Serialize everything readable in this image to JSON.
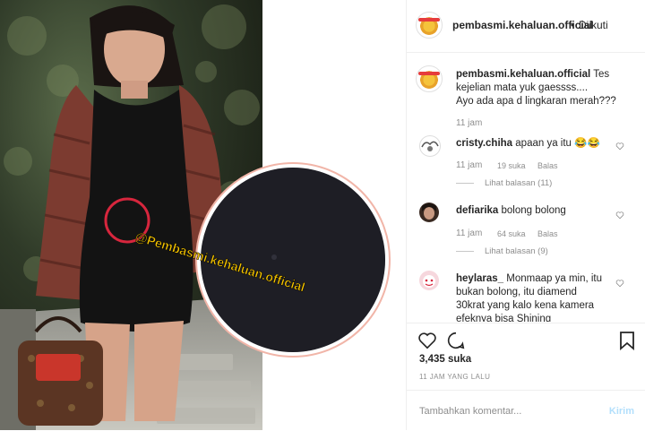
{
  "photo": {
    "watermark": "@Pembasmi.kehaluan.official"
  },
  "header": {
    "username": "pembasmi.kehaluan.official",
    "dot": "•",
    "follow_label": "Diikuti"
  },
  "caption": {
    "username": "pembasmi.kehaluan.official",
    "line1": "Tes",
    "line2": "kejelian mata yuk gaessss....",
    "line3": "Ayo ada apa d lingkaran merah???",
    "time": "11 jam"
  },
  "comments": [
    {
      "username": "cristy.chiha",
      "text": "apaan ya itu 😂😂",
      "time": "11 jam",
      "likes": "19 suka",
      "reply": "Balas",
      "view_replies": "Lihat balasan (11)"
    },
    {
      "username": "defiarika",
      "text": "bolong bolong",
      "time": "11 jam",
      "likes": "64 suka",
      "reply": "Balas",
      "view_replies": "Lihat balasan (9)"
    },
    {
      "username": "heylaras_",
      "text_line1": "Monmaap ya min, itu",
      "text_line2": "bukan bolong, itu diamend",
      "text_line3": "30krat yang kalo kena kamera",
      "text_line4": "efeknya bisa Shining"
    }
  ],
  "footer": {
    "likes": "3,435 suka",
    "time": "11 JAM YANG LALU",
    "comment_placeholder": "Tambahkan komentar...",
    "post_label": "Kirim"
  },
  "colors": {
    "accent_red": "#d7263d",
    "watermark_yellow": "#f5c400",
    "muted": "#8e8e8e",
    "link_blue_disabled": "#b2dffc"
  }
}
